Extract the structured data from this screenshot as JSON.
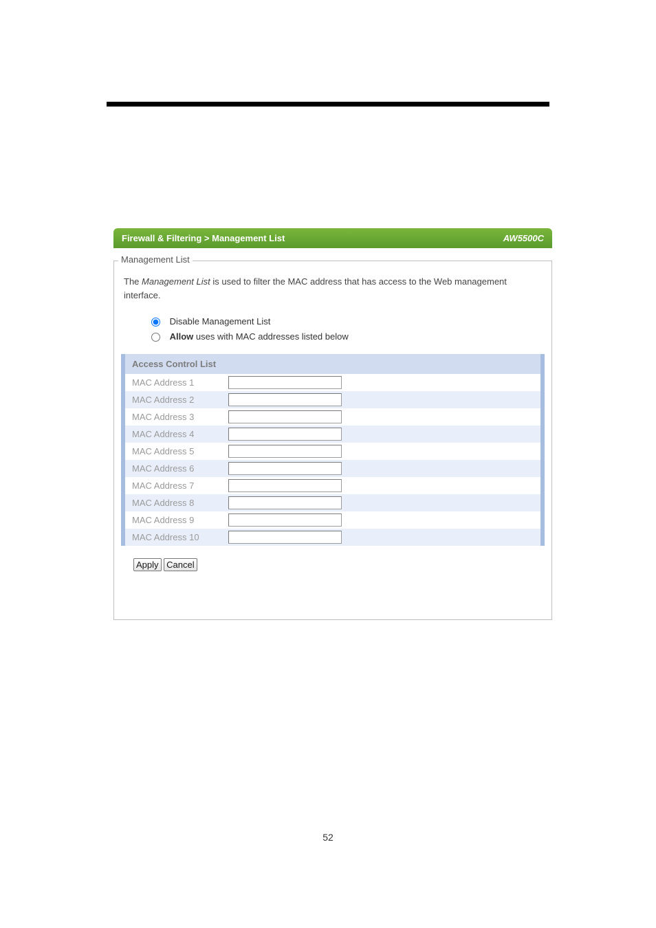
{
  "header": {
    "breadcrumb": "Firewall & Filtering > Management List",
    "model": "AW5500C"
  },
  "fieldset": {
    "legend": "Management List",
    "desc_prefix": "The ",
    "desc_em": "Management List",
    "desc_suffix": " is used to filter the MAC address that has access to the Web management interface."
  },
  "radios": {
    "opt1": "Disable Management List",
    "opt2_bold": "Allow",
    "opt2_rest": " uses with MAC addresses listed below"
  },
  "acl": {
    "header": "Access Control List",
    "rows": [
      {
        "label": "MAC Address 1",
        "value": ""
      },
      {
        "label": "MAC Address 2",
        "value": ""
      },
      {
        "label": "MAC Address 3",
        "value": ""
      },
      {
        "label": "MAC Address 4",
        "value": ""
      },
      {
        "label": "MAC Address 5",
        "value": ""
      },
      {
        "label": "MAC Address 6",
        "value": ""
      },
      {
        "label": "MAC Address 7",
        "value": ""
      },
      {
        "label": "MAC Address 8",
        "value": ""
      },
      {
        "label": "MAC Address 9",
        "value": ""
      },
      {
        "label": "MAC Address 10",
        "value": ""
      }
    ]
  },
  "buttons": {
    "apply": "Apply",
    "cancel": "Cancel"
  },
  "page": "52"
}
